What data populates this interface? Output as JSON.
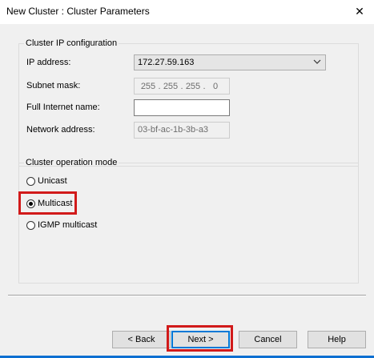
{
  "window": {
    "title": "New Cluster : Cluster Parameters",
    "close_glyph": "✕"
  },
  "ip_config": {
    "legend": "Cluster IP configuration",
    "ip_address_label": "IP address:",
    "ip_address_value": "172.27.59.163",
    "subnet_mask_label": "Subnet mask:",
    "subnet_mask_octets": [
      "255",
      "255",
      "255",
      "0"
    ],
    "full_internet_name_label": "Full Internet name:",
    "full_internet_name_value": "",
    "network_address_label": "Network address:",
    "network_address_value": "03-bf-ac-1b-3b-a3"
  },
  "operation_mode": {
    "legend": "Cluster operation mode",
    "options": [
      {
        "label": "Unicast",
        "checked": false
      },
      {
        "label": "Multicast",
        "checked": true
      },
      {
        "label": "IGMP multicast",
        "checked": false
      }
    ]
  },
  "buttons": {
    "back": "< Back",
    "next": "Next >",
    "cancel": "Cancel",
    "help": "Help"
  },
  "colors": {
    "highlight": "#d11a1a",
    "accent": "#0078d7",
    "taskbar": "#0c6fd1"
  },
  "icons": {
    "close": "close-icon",
    "dropdown": "chevron-down-icon"
  }
}
